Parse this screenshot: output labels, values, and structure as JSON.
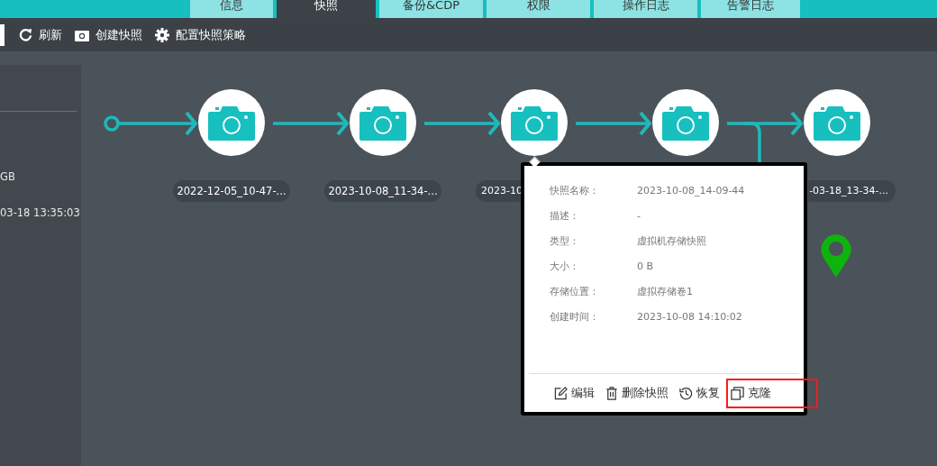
{
  "tabs": [
    {
      "label": "信息",
      "selected": false
    },
    {
      "label": "快照",
      "selected": true
    },
    {
      "label": "备份&CDP",
      "selected": false
    },
    {
      "label": "权限",
      "selected": false
    },
    {
      "label": "操作日志",
      "selected": false
    },
    {
      "label": "告警日志",
      "selected": false
    }
  ],
  "toolbar": [
    {
      "label": "刷新",
      "kind": "refresh"
    },
    {
      "label": "创建快照",
      "kind": "camera"
    },
    {
      "label": "配置快照策略",
      "kind": "gear"
    }
  ],
  "side_panel": {
    "texts": [
      "GB",
      "03-18 13:35:03"
    ]
  },
  "timeline": {
    "snapshots": [
      {
        "kind": "snapshot",
        "label": "2022-12-05_10-47-..."
      },
      {
        "kind": "snapshot",
        "label": "2023-10-08_11-34-..."
      },
      {
        "kind": "snapshot",
        "label": "2023-10",
        "covered_right": true
      },
      {
        "kind": "snapshot"
      },
      {
        "kind": "snapshot",
        "label": "-03-18_13-34-...",
        "covered_left": true
      }
    ],
    "current_marker": true
  },
  "popup": {
    "fields": [
      {
        "label": "快照名称：",
        "value": "2023-10-08_14-09-44"
      },
      {
        "label": "描述：",
        "value": "-"
      },
      {
        "label": "类型：",
        "value": "虚拟机存储快照"
      },
      {
        "label": "大小：",
        "value": "0 B"
      },
      {
        "label": "存储位置：",
        "value": "虚拟存储卷1"
      },
      {
        "label": "创建时间：",
        "value": "2023-10-08 14:10:02"
      }
    ],
    "actions": [
      {
        "label": "编辑",
        "kind": "edit",
        "highlighted": false
      },
      {
        "label": "删除快照",
        "kind": "delete",
        "highlighted": false
      },
      {
        "label": "恢复",
        "kind": "restore",
        "highlighted": false
      },
      {
        "label": "克隆",
        "kind": "clone",
        "highlighted": true
      }
    ]
  }
}
